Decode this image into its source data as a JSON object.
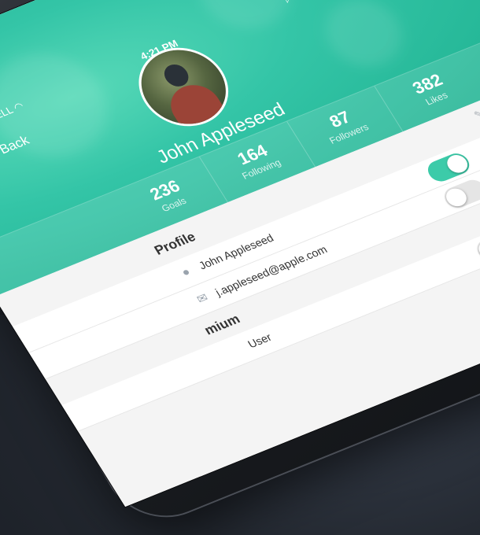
{
  "status_bar": {
    "carrier": "BELL",
    "time": "4:21 PM"
  },
  "nav": {
    "back_label": "Back"
  },
  "profile": {
    "name": "John Appleseed",
    "avatar_icon": "person-avatar"
  },
  "stats": [
    {
      "value": "236",
      "label": "Goals"
    },
    {
      "value": "164",
      "label": "Following"
    },
    {
      "value": "87",
      "label": "Followers"
    },
    {
      "value": "382",
      "label": "Likes"
    }
  ],
  "profile_section": {
    "title": "Profile",
    "rows": [
      {
        "icon": "user-icon",
        "text": "John Appleseed"
      },
      {
        "icon": "mail-icon",
        "text": "j.appleseed@apple.com"
      }
    ]
  },
  "premium_section": {
    "title_partial": "mium",
    "row_partial": "User"
  },
  "toggles": [
    {
      "state": "on"
    },
    {
      "state": "off"
    },
    {
      "state": "off"
    }
  ],
  "colors": {
    "accent": "#34c5a7",
    "toggle_on": "#3ccba9",
    "toggle_off": "#e5e5e5"
  }
}
